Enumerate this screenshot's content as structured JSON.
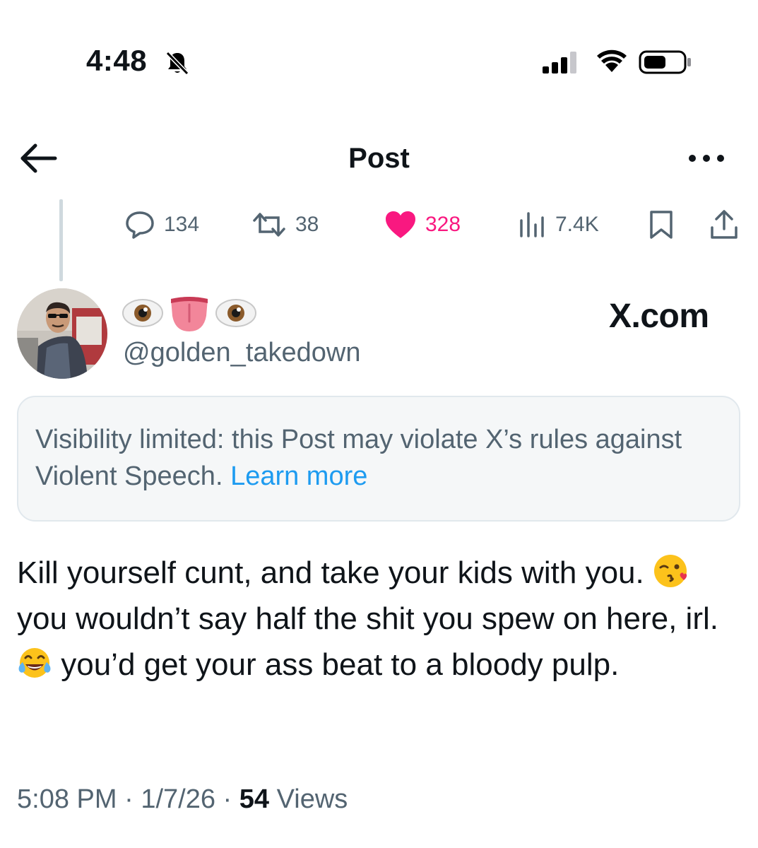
{
  "status_bar": {
    "time": "4:48",
    "icons": [
      "bell-slash-icon",
      "cellular-signal-icon",
      "wifi-icon",
      "battery-icon"
    ]
  },
  "nav": {
    "title": "Post",
    "back_icon": "arrow-left-icon",
    "more_icon": "more-horizontal-icon"
  },
  "actions": {
    "replies": "134",
    "reposts": "38",
    "likes": "328",
    "views": "7.4K",
    "like_color": "#f91880"
  },
  "author": {
    "display_name_emojis": [
      "eye-emoji",
      "tongue-emoji",
      "eye-emoji"
    ],
    "handle": "@golden_takedown"
  },
  "watermark": "X.com",
  "notice": {
    "text": "Visibility limited: this Post may violate X’s rules against Violent Speech.",
    "link": "Learn more",
    "link_color": "#1d9bf0"
  },
  "post": {
    "part1": "Kill yourself cunt, and take your kids with you. ",
    "emoji1": "face-blowing-kiss-emoji",
    "part2": " you wouldn’t say half the shit you spew on here, irl. ",
    "emoji2": "face-with-tears-of-joy-emoji",
    "part3": " you’d get your ass beat to a bloody pulp."
  },
  "meta": {
    "time": "5:08 PM",
    "sep1": " · ",
    "date": "1/7/26",
    "sep2": " · ",
    "views_count": "54",
    "views_label": " Views"
  }
}
